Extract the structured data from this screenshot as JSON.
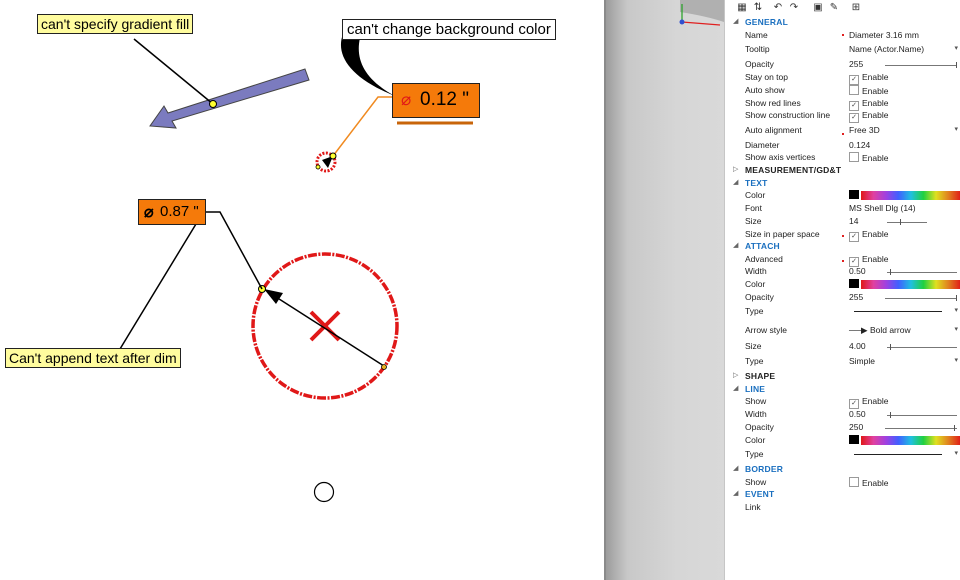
{
  "canvas": {
    "callouts": {
      "gradient": "can't specify gradient fill",
      "background": "can't change background color",
      "append_text": "Can't append text after dim"
    },
    "dimensions": {
      "top_label": "0.12 \"",
      "circle_label": "0.87 \""
    }
  },
  "panel": {
    "toolbar_icons": [
      "categorized-icon",
      "sort-az-icon",
      "undo-icon",
      "redo-icon",
      "properties-icon",
      "pin-icon",
      "export-icon"
    ],
    "general": {
      "title": "GENERAL",
      "name_label": "Name",
      "name_value": "Diameter 3.16 mm",
      "tooltip_label": "Tooltip",
      "tooltip_value": "Name (Actor.Name)",
      "opacity_label": "Opacity",
      "opacity_value": "255",
      "stay_on_top_label": "Stay on top",
      "stay_on_top_value": "Enable",
      "auto_show_label": "Auto show",
      "auto_show_value": "Enable",
      "show_red_lines_label": "Show red lines",
      "show_red_lines_value": "Enable",
      "show_construction_line_label": "Show construction line",
      "show_construction_line_value": "Enable",
      "auto_alignment_label": "Auto alignment",
      "auto_alignment_value": "Free 3D",
      "diameter_label": "Diameter",
      "diameter_value": "0.124",
      "show_axis_vertices_label": "Show axis vertices",
      "show_axis_vertices_value": "Enable"
    },
    "measurement": {
      "title": "MEASUREMENT/GD&T"
    },
    "text": {
      "title": "TEXT",
      "color_label": "Color",
      "font_label": "Font",
      "font_value": "MS Shell Dlg (14)",
      "size_label": "Size",
      "size_value": "14",
      "size_in_paper_space_label": "Size in paper space",
      "size_in_paper_space_value": "Enable"
    },
    "attach": {
      "title": "ATTACH",
      "advanced_label": "Advanced",
      "advanced_value": "Enable",
      "width_label": "Width",
      "width_value": "0.50",
      "color_label": "Color",
      "opacity_label": "Opacity",
      "opacity_value": "255",
      "type_label": "Type",
      "arrow_style_label": "Arrow style",
      "arrow_style_value": "Bold arrow",
      "size_label": "Size",
      "size_value": "4.00",
      "type2_label": "Type",
      "type2_value": "Simple"
    },
    "shape": {
      "title": "SHAPE"
    },
    "line": {
      "title": "LINE",
      "show_label": "Show",
      "show_value": "Enable",
      "width_label": "Width",
      "width_value": "0.50",
      "opacity_label": "Opacity",
      "opacity_value": "250",
      "color_label": "Color",
      "type_label": "Type"
    },
    "border": {
      "title": "BORDER",
      "show_label": "Show",
      "show_value": "Enable"
    },
    "event": {
      "title": "EVENT",
      "link_label": "Link"
    }
  },
  "colors": {
    "accent_section": "#1a6fbf",
    "dimension_box": "#f57a0a",
    "circle_red": "#e01818",
    "callout_yellow": "#fffc9e",
    "arrow_purple": "#7b7bbf"
  }
}
